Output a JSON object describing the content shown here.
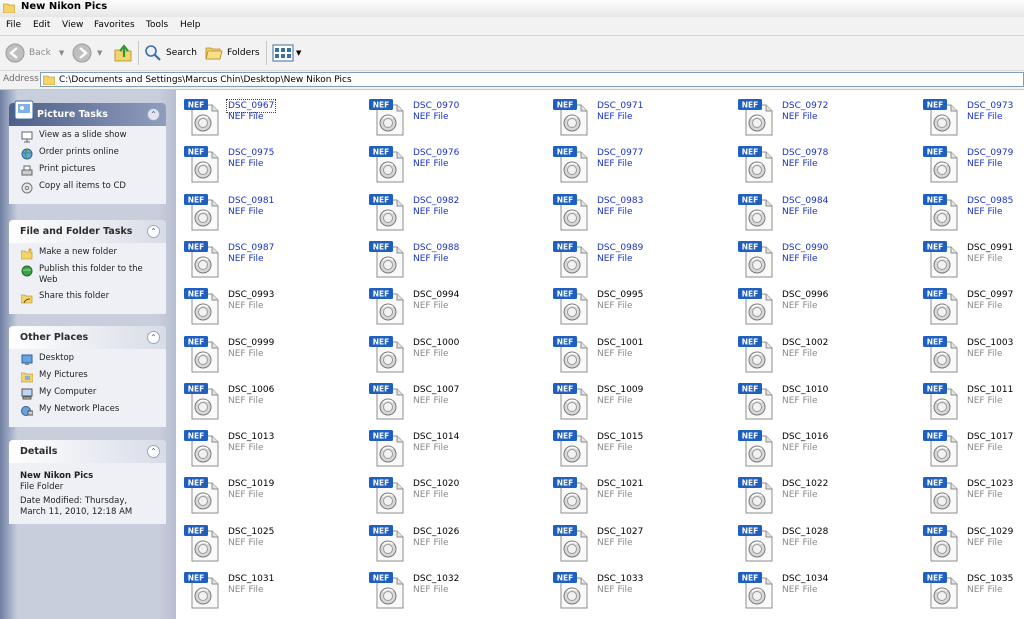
{
  "window": {
    "title": "New Nikon Pics"
  },
  "menu": [
    "File",
    "Edit",
    "View",
    "Favorites",
    "Tools",
    "Help"
  ],
  "toolbar": {
    "back": "Back",
    "search": "Search",
    "folders": "Folders"
  },
  "address": {
    "label": "Address",
    "path": "C:\\Documents and Settings\\Marcus Chin\\Desktop\\New Nikon Pics"
  },
  "panels": {
    "picture_tasks": {
      "title": "Picture Tasks",
      "items": [
        "View as a slide show",
        "Order prints online",
        "Print pictures",
        "Copy all items to CD"
      ]
    },
    "file_folder_tasks": {
      "title": "File and Folder Tasks",
      "items": [
        "Make a new folder",
        "Publish this folder to the Web",
        "Share this folder"
      ]
    },
    "other_places": {
      "title": "Other Places",
      "items": [
        "Desktop",
        "My Pictures",
        "My Computer",
        "My Network Places"
      ]
    },
    "details": {
      "title": "Details",
      "name": "New Nikon Pics",
      "type": "File Folder",
      "modified": "Date Modified: Thursday, March 11, 2010, 12:18 AM"
    }
  },
  "file_badge": "NEF",
  "files": [
    {
      "name": "DSC_0967",
      "type": "NEF File",
      "selected": true
    },
    {
      "name": "DSC_0970",
      "type": "NEF File",
      "selected": true
    },
    {
      "name": "DSC_0971",
      "type": "NEF File",
      "selected": true
    },
    {
      "name": "DSC_0972",
      "type": "NEF File",
      "selected": true
    },
    {
      "name": "DSC_0973",
      "type": "NEF File",
      "selected": true
    },
    {
      "name": "DSC_0975",
      "type": "NEF File",
      "selected": true
    },
    {
      "name": "DSC_0976",
      "type": "NEF File",
      "selected": true
    },
    {
      "name": "DSC_0977",
      "type": "NEF File",
      "selected": true
    },
    {
      "name": "DSC_0978",
      "type": "NEF File",
      "selected": true
    },
    {
      "name": "DSC_0979",
      "type": "NEF File",
      "selected": true
    },
    {
      "name": "DSC_0981",
      "type": "NEF File",
      "selected": true
    },
    {
      "name": "DSC_0982",
      "type": "NEF File",
      "selected": true
    },
    {
      "name": "DSC_0983",
      "type": "NEF File",
      "selected": true
    },
    {
      "name": "DSC_0984",
      "type": "NEF File",
      "selected": true
    },
    {
      "name": "DSC_0985",
      "type": "NEF File",
      "selected": true
    },
    {
      "name": "DSC_0987",
      "type": "NEF File",
      "selected": true
    },
    {
      "name": "DSC_0988",
      "type": "NEF File",
      "selected": true
    },
    {
      "name": "DSC_0989",
      "type": "NEF File",
      "selected": true
    },
    {
      "name": "DSC_0990",
      "type": "NEF File",
      "selected": true
    },
    {
      "name": "DSC_0991",
      "type": "NEF File",
      "selected": false
    },
    {
      "name": "DSC_0993",
      "type": "NEF File",
      "selected": false
    },
    {
      "name": "DSC_0994",
      "type": "NEF File",
      "selected": false
    },
    {
      "name": "DSC_0995",
      "type": "NEF File",
      "selected": false
    },
    {
      "name": "DSC_0996",
      "type": "NEF File",
      "selected": false
    },
    {
      "name": "DSC_0997",
      "type": "NEF File",
      "selected": false
    },
    {
      "name": "DSC_0999",
      "type": "NEF File",
      "selected": false
    },
    {
      "name": "DSC_1000",
      "type": "NEF File",
      "selected": false
    },
    {
      "name": "DSC_1001",
      "type": "NEF File",
      "selected": false
    },
    {
      "name": "DSC_1002",
      "type": "NEF File",
      "selected": false
    },
    {
      "name": "DSC_1003",
      "type": "NEF File",
      "selected": false
    },
    {
      "name": "DSC_1006",
      "type": "NEF File",
      "selected": false
    },
    {
      "name": "DSC_1007",
      "type": "NEF File",
      "selected": false
    },
    {
      "name": "DSC_1009",
      "type": "NEF File",
      "selected": false
    },
    {
      "name": "DSC_1010",
      "type": "NEF File",
      "selected": false
    },
    {
      "name": "DSC_1011",
      "type": "NEF File",
      "selected": false
    },
    {
      "name": "DSC_1013",
      "type": "NEF File",
      "selected": false
    },
    {
      "name": "DSC_1014",
      "type": "NEF File",
      "selected": false
    },
    {
      "name": "DSC_1015",
      "type": "NEF File",
      "selected": false
    },
    {
      "name": "DSC_1016",
      "type": "NEF File",
      "selected": false
    },
    {
      "name": "DSC_1017",
      "type": "NEF File",
      "selected": false
    },
    {
      "name": "DSC_1019",
      "type": "NEF File",
      "selected": false
    },
    {
      "name": "DSC_1020",
      "type": "NEF File",
      "selected": false
    },
    {
      "name": "DSC_1021",
      "type": "NEF File",
      "selected": false
    },
    {
      "name": "DSC_1022",
      "type": "NEF File",
      "selected": false
    },
    {
      "name": "DSC_1023",
      "type": "NEF File",
      "selected": false
    },
    {
      "name": "DSC_1025",
      "type": "NEF File",
      "selected": false
    },
    {
      "name": "DSC_1026",
      "type": "NEF File",
      "selected": false
    },
    {
      "name": "DSC_1027",
      "type": "NEF File",
      "selected": false
    },
    {
      "name": "DSC_1028",
      "type": "NEF File",
      "selected": false
    },
    {
      "name": "DSC_1029",
      "type": "NEF File",
      "selected": false
    },
    {
      "name": "DSC_1031",
      "type": "NEF File",
      "selected": false
    },
    {
      "name": "DSC_1032",
      "type": "NEF File",
      "selected": false
    },
    {
      "name": "DSC_1033",
      "type": "NEF File",
      "selected": false
    },
    {
      "name": "DSC_1034",
      "type": "NEF File",
      "selected": false
    },
    {
      "name": "DSC_1035",
      "type": "NEF File",
      "selected": false
    }
  ],
  "colors": {
    "selected_text": "#1a33c2",
    "muted_text": "#8a8a8a",
    "badge": "#1f5fbf",
    "task_header": "#4e5f88"
  }
}
